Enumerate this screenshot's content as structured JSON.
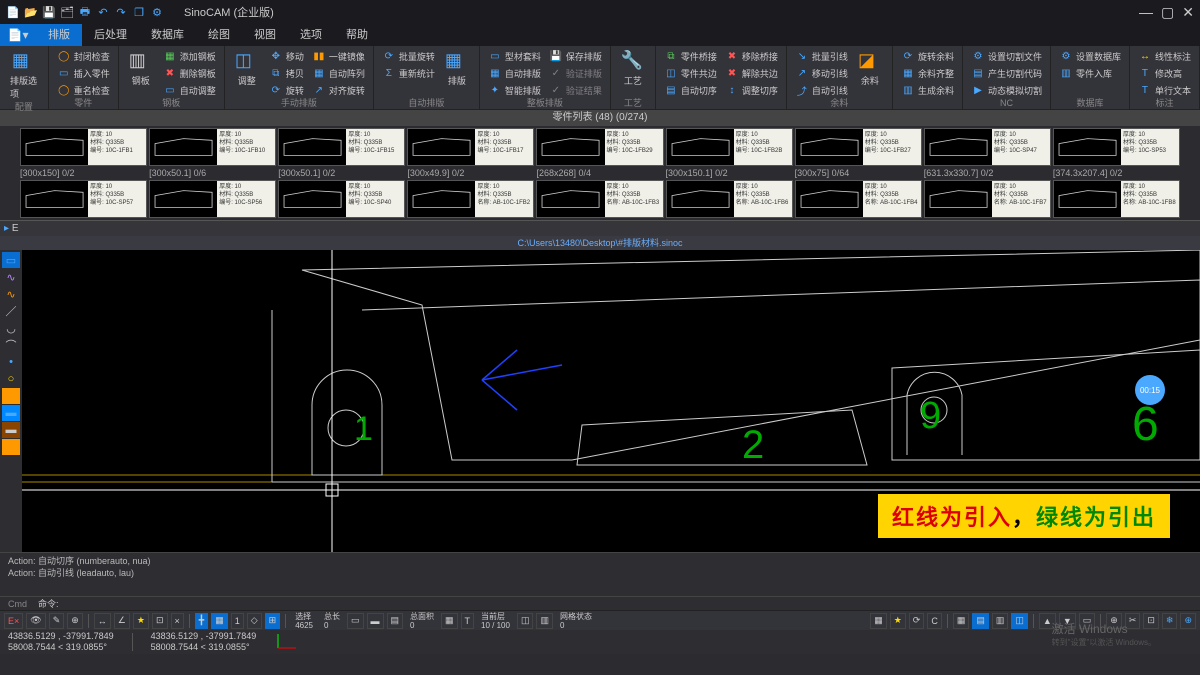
{
  "app": {
    "title": "SinoCAM (企业版)"
  },
  "menu": {
    "tabs": [
      "排版",
      "后处理",
      "数据库",
      "绘图",
      "视图",
      "选项",
      "帮助"
    ],
    "active": "排版"
  },
  "ribbon": {
    "g0": {
      "label": "配置",
      "big": "排版选项"
    },
    "g1": {
      "label": "零件",
      "a": "封闭检查",
      "b": "插入零件",
      "c": "重名检查"
    },
    "g2": {
      "label": "钢板",
      "big": "钢板",
      "a": "添加钢板",
      "b": "删除钢板",
      "c": "自动调整"
    },
    "g3": {
      "label": "手动排版",
      "big": "调整",
      "a": "移动",
      "b": "拷贝",
      "c": "旋转",
      "d": "一键镜像",
      "e": "自动阵列",
      "f": "对齐旋转"
    },
    "g4": {
      "label": "自动排版",
      "a": "批量旋转",
      "b": "重新统计",
      "big": "排版"
    },
    "g5": {
      "label": "整板排版",
      "a": "型材套料",
      "b": "自动排版",
      "c": "智能排版",
      "d": "保存排版",
      "e": "验证排版",
      "f": "验证结果"
    },
    "g6": {
      "big": "工艺",
      "label": "工艺"
    },
    "g7": {
      "a": "零件桥接",
      "b": "零件共边",
      "c": "自动切序",
      "d": "移除桥接",
      "e": "解除共边",
      "f": "调整切序",
      "label": ""
    },
    "g8": {
      "a": "批量引线",
      "b": "移动引线",
      "c": "自动引线",
      "big": "余料",
      "label": "余料"
    },
    "g9": {
      "a": "旋转余料",
      "b": "余料齐整",
      "c": "生成余料",
      "label": ""
    },
    "g10": {
      "a": "设置切割文件",
      "b": "产生切割代码",
      "c": "动态模拟切割",
      "label": "NC"
    },
    "g11": {
      "a": "设置数据库",
      "b": "零件入库",
      "label": "数据库"
    },
    "g12": {
      "a": "线性标注",
      "b": "修改高",
      "c": "单行文本",
      "label": "标注"
    }
  },
  "partlist": {
    "header": "零件列表 (48) (0/274)",
    "row1": [
      {
        "dims": "[300x150] 0/2",
        "厚度": "10",
        "材料": "Q335B",
        "编号": "10C-1FB1"
      },
      {
        "dims": "[300x50.1] 0/6",
        "厚度": "10",
        "材料": "Q335B",
        "编号": "10C-1FB10"
      },
      {
        "dims": "[300x50.1] 0/2",
        "厚度": "10",
        "材料": "Q335B",
        "编号": "10C-1FB15"
      },
      {
        "dims": "[300x49.9] 0/2",
        "厚度": "10",
        "材料": "Q335B",
        "编号": "10C-1FB17"
      },
      {
        "dims": "[268x268] 0/4",
        "厚度": "10",
        "材料": "Q335B",
        "编号": "10C-1FB29"
      },
      {
        "dims": "[300x150.1] 0/2",
        "厚度": "10",
        "材料": "Q335B",
        "编号": "10C-1FB2B"
      },
      {
        "dims": "[300x75] 0/64",
        "厚度": "10",
        "材料": "Q335B",
        "编号": "10C-1FB27"
      },
      {
        "dims": "[631.3x330.7] 0/2",
        "厚度": "10",
        "材料": "Q335B",
        "编号": "10C-SP47"
      },
      {
        "dims": "[374.3x207.4] 0/2",
        "厚度": "10",
        "材料": "Q335B",
        "编号": "10C-SP53"
      }
    ],
    "row2": [
      {
        "厚度": "10",
        "材料": "Q335B",
        "编号": "10C-SP57"
      },
      {
        "厚度": "10",
        "材料": "Q335B",
        "编号": "10C-SP56"
      },
      {
        "厚度": "10",
        "材料": "Q335B",
        "编号": "10C-SP40"
      },
      {
        "厚度": "10",
        "材料": "Q335B",
        "名称": "AB-10C-1FB2"
      },
      {
        "厚度": "10",
        "材料": "Q335B",
        "名称": "AB-10C-1FB3"
      },
      {
        "厚度": "10",
        "材料": "Q335B",
        "名称": "AB-10C-1FB6"
      },
      {
        "厚度": "10",
        "材料": "Q335B",
        "名称": "AB-10C-1FB4"
      },
      {
        "厚度": "10",
        "材料": "Q335B",
        "名称": "AB-10C-1FB7"
      },
      {
        "厚度": "10",
        "材料": "Q335B",
        "名称": "AB-10C-1FB8"
      }
    ]
  },
  "doc": {
    "tab": "E",
    "path": "C:\\Users\\13480\\Desktop\\#排版材料.sinoc"
  },
  "banner": {
    "a": "红线为引入",
    "sep": "，",
    "b": "绿线为引出"
  },
  "timer": "00:15",
  "cmd": {
    "l1": "Action: 自动切序 (numberauto, nua)",
    "l2": "Action: 自动引线 (leadauto, lau)",
    "prompt": "命令:",
    "label": "Cmd"
  },
  "status": {
    "coords1a": "43836.5129 , -37991.7849",
    "coords1b": "58008.7544 < 319.0855°",
    "coords2a": "43836.5129 , -37991.7849",
    "coords2b": "58008.7544 < 319.0855°",
    "选择_l": "选择",
    "选择_v": "4625",
    "总长_l": "总长",
    "总长_v": "0",
    "总面积_l": "总面积",
    "总面积_v": "0",
    "当前层_l": "当前层",
    "当前层_v": "10 / 100",
    "网格状态_l": "网格状态",
    "网格状态_v": "0"
  },
  "watermark": {
    "a": "激活 Windows",
    "b": "转到\"设置\"以激活 Windows。"
  }
}
